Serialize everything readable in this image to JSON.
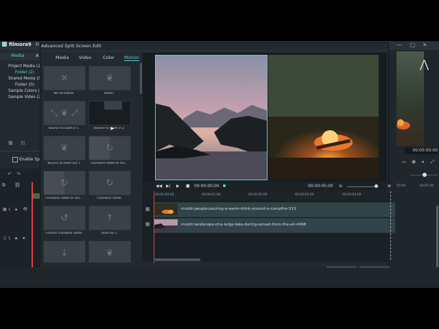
{
  "app": {
    "name": "filmora9",
    "title_partial": "Fi"
  },
  "dialog": {
    "title": "Advanced Split Screen Edit",
    "tabs": [
      "Media",
      "Video",
      "Color",
      "Motion"
    ],
    "active_tab": "Motion",
    "motions": [
      "No Animation",
      "Boom!",
      "Bounce to zoom in 1",
      "Bounce to zoom in 2",
      "Bounce to zoom out 1",
      "Clockwise rotate to zoo...",
      "Clockwise rotate to zoo...",
      "Clockwise rotate",
      "Counter clockwise rotate",
      "Dove Up 1",
      "",
      ""
    ]
  },
  "library": {
    "tabs": [
      "Media",
      "A"
    ],
    "items": [
      "Project Media (2)",
      "Folder (2)",
      "Shared Media (0)",
      "Folder (0)",
      "Sample Colors (1",
      "Sample Video (2"
    ],
    "enable_label": "Enable Spl"
  },
  "transport": {
    "current_time": "00:00:00:00",
    "duration": "00:00:05:00"
  },
  "ruler": [
    "00:00:00:00",
    "00:00:01:00",
    "00:00:02:00",
    "00:00:03:00",
    "00:00:04:00"
  ],
  "tracks": [
    {
      "name": "mixkit-people-pouring-a-warm-drink-around-a-campfire-513"
    },
    {
      "name": "mixkit-landscape-of-a-large-lake-during-sunset-from-the-air-4998"
    }
  ],
  "right_panel": {
    "timecode": "00:00:00:00",
    "ruler_a": "55:00",
    "ruler_b": "00:01:00"
  },
  "main_tracks": {
    "video_label": "1",
    "audio_label": "1"
  },
  "colors": {
    "accent": "#5fd1cf",
    "playhead": "#e24545"
  }
}
